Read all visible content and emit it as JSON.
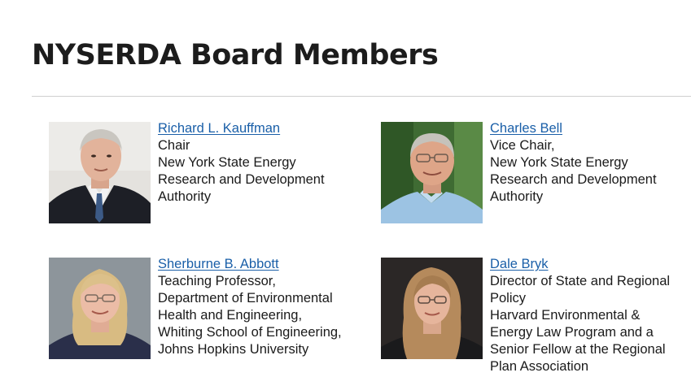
{
  "page": {
    "title": "NYSERDA Board Members"
  },
  "members": [
    {
      "name": "Richard L. Kauffman",
      "lines": [
        "Chair",
        "New York State Energy",
        "Research and Development",
        "Authority"
      ],
      "photo": "portrait-photo"
    },
    {
      "name": "Charles Bell",
      "lines": [
        "Vice Chair,",
        "New York State Energy",
        "Research and Development",
        "Authority"
      ],
      "photo": "portrait-photo"
    },
    {
      "name": "Sherburne B. Abbott",
      "lines": [
        "Teaching Professor,",
        "Department of Environmental",
        "Health and Engineering,",
        "Whiting School of Engineering,",
        "Johns Hopkins University"
      ],
      "photo": "portrait-photo"
    },
    {
      "name": "Dale Bryk",
      "lines": [
        "Director of State and Regional",
        "Policy",
        "Harvard Environmental &",
        "Energy Law Program and a",
        "Senior Fellow at the Regional",
        "Plan Association"
      ],
      "photo": "portrait-photo"
    }
  ],
  "colors": {
    "link": "#1a5fa8",
    "divider": "#cfcfcf",
    "title": "#1c1c1c"
  }
}
